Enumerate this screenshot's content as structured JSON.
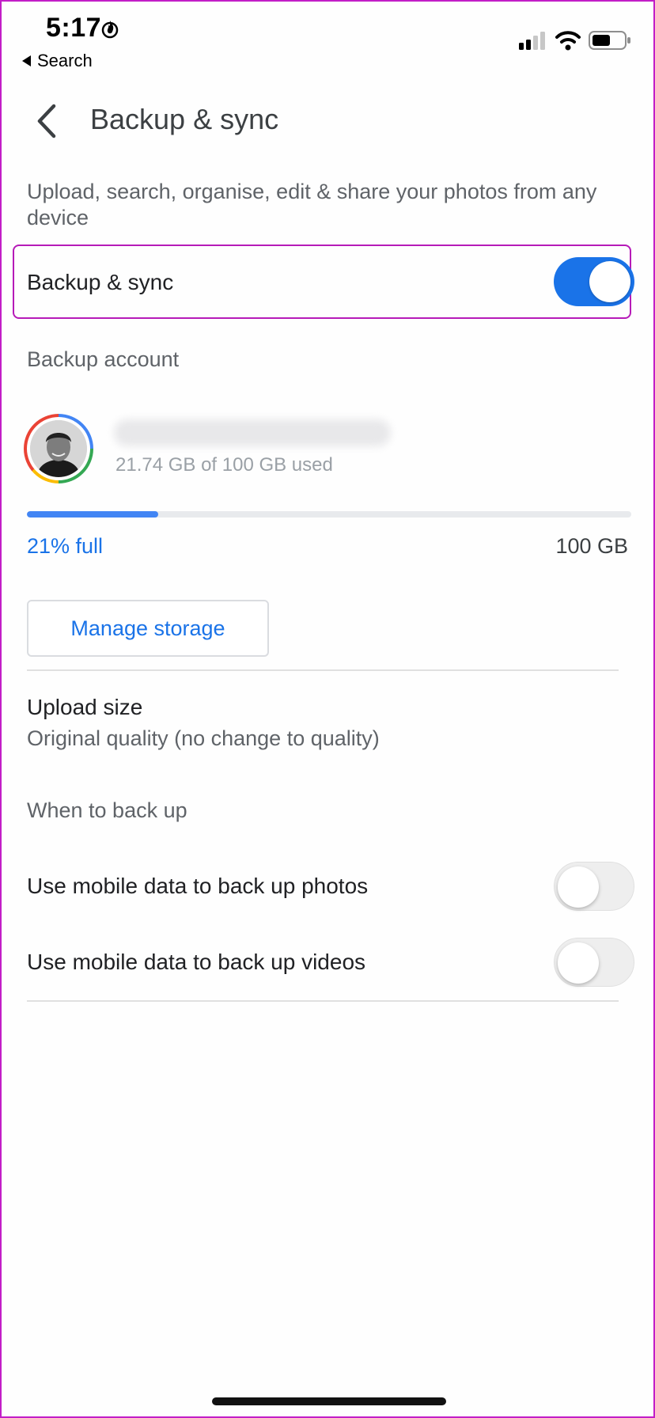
{
  "status_bar": {
    "time": "5:17",
    "back_app_label": "Search",
    "icons": [
      "flame-icon",
      "signal-icon",
      "wifi-icon",
      "battery-icon"
    ]
  },
  "app_bar": {
    "title": "Backup & sync",
    "back_icon": "back-arrow-icon"
  },
  "description": "Upload, search, organise, edit & share your photos from any device",
  "backup_sync": {
    "label": "Backup & sync",
    "enabled": true
  },
  "backup_account": {
    "section_label": "Backup account",
    "email": "",
    "usage_text": "21.74 GB of 100 GB used",
    "percent_label": "21% full",
    "capacity_label": "100 GB",
    "used_fraction": 0.2174
  },
  "manage_storage_label": "Manage storage",
  "upload_size": {
    "title": "Upload size",
    "value": "Original quality (no change to quality)"
  },
  "when_to_back_up": {
    "section_label": "When to back up",
    "items": [
      {
        "label": "Use mobile data to back up photos",
        "enabled": false
      },
      {
        "label": "Use mobile data to back up videos",
        "enabled": false
      }
    ]
  },
  "colors": {
    "accent": "#1a73e8",
    "highlight_border": "#b61ab8",
    "progress": "#4285f4"
  }
}
